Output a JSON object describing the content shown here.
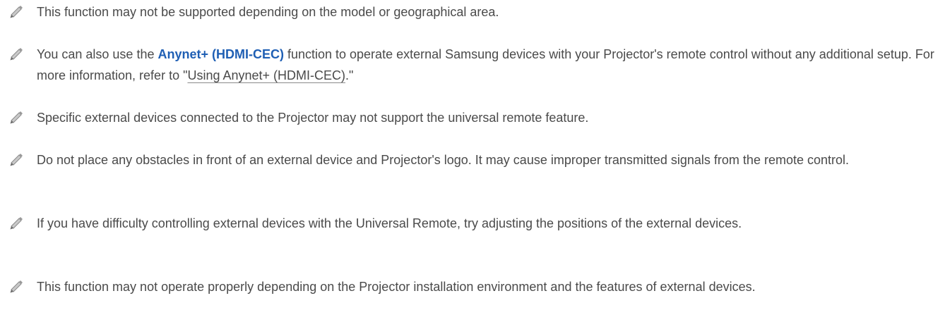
{
  "notes": [
    {
      "icon": "pencil-note-icon",
      "text": "This function may not be supported depending on the model or geographical area."
    },
    {
      "icon": "pencil-note-icon",
      "text_before": "You can also use the ",
      "highlight": "Anynet+ (HDMI-CEC)",
      "text_middle": " function to operate external Samsung devices with your Projector's remote control without any additional setup. For more information, refer to \"",
      "reference": "Using Anynet+ (HDMI-CEC)",
      "text_after": ".\""
    },
    {
      "icon": "pencil-note-icon",
      "text": "Specific external devices connected to the Projector may not support the universal remote feature."
    },
    {
      "icon": "pencil-note-icon",
      "text": "Do not place any obstacles in front of an external device and Projector's logo. It may cause improper transmitted signals from the remote control."
    },
    {
      "icon": "pencil-note-icon",
      "text": "If you have difficulty controlling external devices with the Universal Remote, try adjusting the positions of the external devices."
    },
    {
      "icon": "pencil-note-icon",
      "text": "This function may not operate properly depending on the Projector installation environment and the features of external devices."
    }
  ],
  "colors": {
    "body_text": "#4a4a4a",
    "highlight": "#1f5fb4",
    "icon_fill": "#c9c9c9",
    "icon_stroke": "#8a8a8a"
  }
}
